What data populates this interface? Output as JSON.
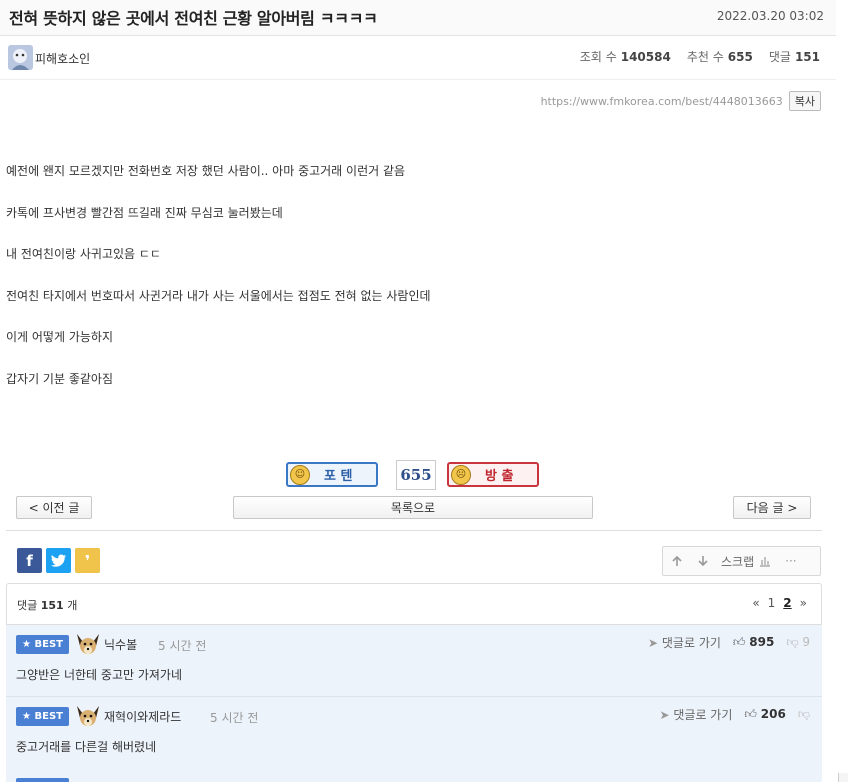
{
  "post": {
    "title": "전혀 뜻하지 않은 곳에서 전여친 근황 알아버림 ㅋㅋㅋㅋ",
    "date": "2022.03.20 03:02",
    "author": "피해호소인",
    "views_label": "조회 수",
    "views": "140584",
    "recommend_label": "추천 수",
    "recommend": "655",
    "comments_label": "댓글",
    "comments": "151",
    "url": "https://www.fmkorea.com/best/4448013663",
    "copy_label": "복사",
    "body": [
      "예전에 왠지 모르겠지만 전화번호 저장 했던 사람이.. 아마 중고거래 이런거 같음",
      "카톡에 프사변경 빨간점 뜨길래 진짜 무심코 눌러봤는데",
      "내 전여친이랑 사귀고있음 ㄷㄷ",
      "전여친 타지에서 번호따서 사귄거라 내가 사는 서울에서는 접점도 전혀 없는 사람인데",
      "이게 어떻게 가능하지",
      "갑자기 기분 좋같아짐"
    ]
  },
  "vote": {
    "up_label": "포 텐",
    "count": "655",
    "down_label": "방 출"
  },
  "nav": {
    "prev": "< 이전 글",
    "list": "목록으로",
    "next": "다음 글 >"
  },
  "tools": {
    "scrap": "스크랩",
    "more": "···"
  },
  "comments_section": {
    "label_prefix": "댓글",
    "count": "151",
    "label_suffix": "개",
    "pages": [
      "«",
      "1",
      "2",
      "»"
    ]
  },
  "comment_list": [
    {
      "badge": "BEST",
      "name": "닉수볼",
      "time": "5 시간 전",
      "reply": "댓글로 가기",
      "likes": "895",
      "dislikes": "9",
      "text": "그양반은 너한테 중고만 가져가네"
    },
    {
      "badge": "BEST",
      "name": "재혁이와제라드",
      "time": "5 시간 전",
      "reply": "댓글로 가기",
      "likes": "206",
      "dislikes": "",
      "text": "중고거래를 다른걸 해버렸네"
    }
  ],
  "colors": {
    "best_badge": "#4a80d4",
    "comment_bg": "#edf3fb",
    "vote_up": "#3a78c5",
    "vote_down": "#c9353d"
  }
}
